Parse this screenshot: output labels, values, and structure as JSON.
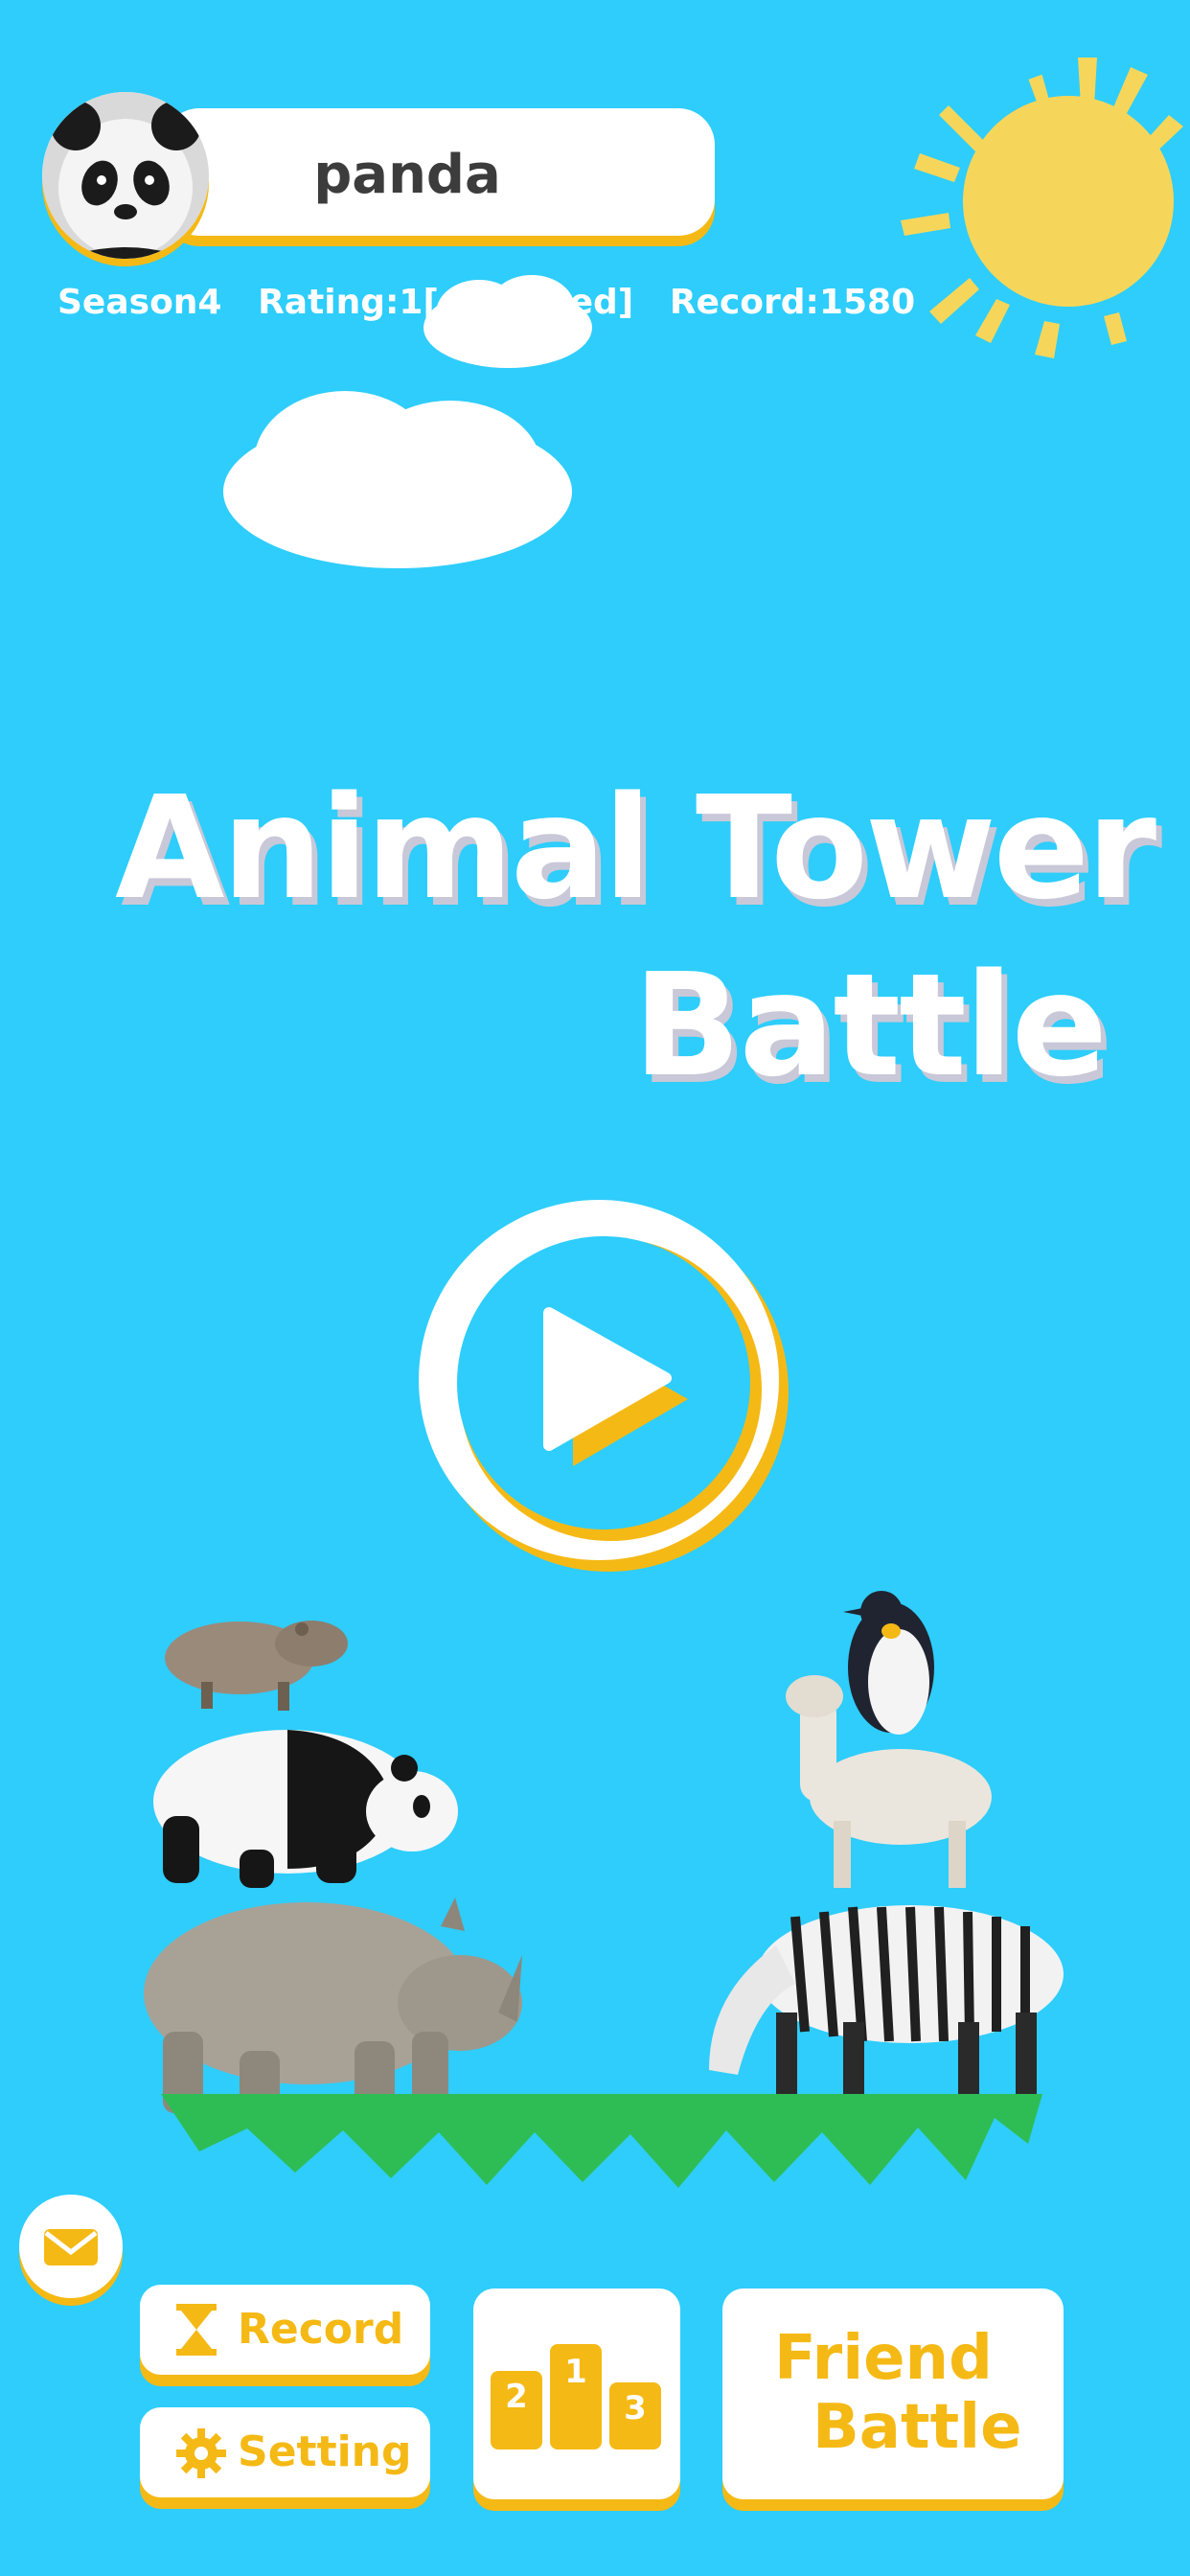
{
  "profile": {
    "name": "panda",
    "stats_text": "Season4   Rating:1[obscured]   Record:1580"
  },
  "title": {
    "line1": "Animal Tower",
    "line2": "Battle"
  },
  "buttons": {
    "record": "Record",
    "setting": "Setting",
    "friend_battle_line1": "Friend",
    "friend_battle_line2": "Battle",
    "rank_numbers": [
      "2",
      "1",
      "3"
    ]
  },
  "colors": {
    "background": "#2ecdfb",
    "accent": "#f5b915",
    "sun": "#f6d65a",
    "ground": "#2ebd55"
  },
  "icons": [
    "play-icon",
    "mail-icon",
    "hourglass-icon",
    "gear-icon",
    "podium-icon",
    "sun-icon"
  ]
}
